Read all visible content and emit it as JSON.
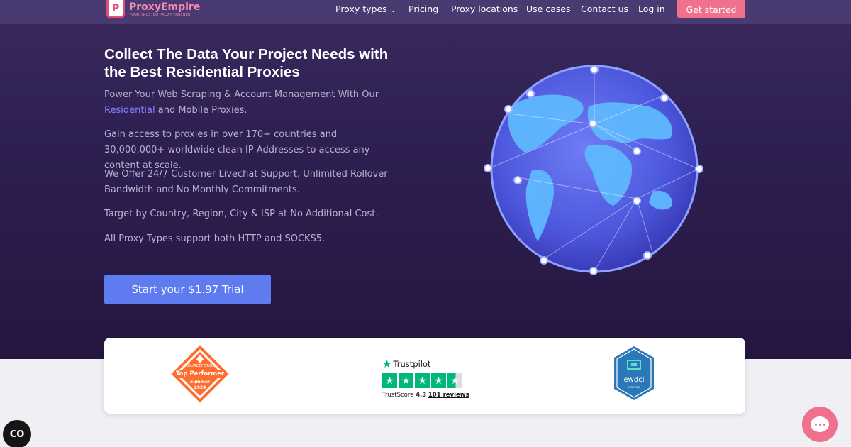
{
  "header": {
    "logo": {
      "name_part1": "Proxy",
      "name_part2": "Empire",
      "tagline": "YOUR TRUSTED PROXY PARTNER"
    },
    "nav": [
      {
        "label": "Proxy types",
        "has_dropdown": true
      },
      {
        "label": "Pricing"
      },
      {
        "label": "Proxy locations"
      },
      {
        "label": "Use cases"
      },
      {
        "label": "Contact us"
      },
      {
        "label": "Log in"
      }
    ],
    "cta_label": "Get started"
  },
  "hero": {
    "title": "Collect The Data Your Project Needs with the Best Residential Proxies",
    "p1_before": "Power Your Web Scraping & Account Management With Our ",
    "p1_link": "Residential",
    "p1_after": " and Mobile Proxies.",
    "p2": "Gain access to proxies in over 170+ countries and 30,000,000+ worldwide clean IP Addresses to access any content at scale.",
    "p3": "We Offer 24/7 Customer Livechat Support, Unlimited Rollover Bandwidth and No Monthly Commitments.",
    "p4": "Target by Country, Region, City & ISP at No Additional Cost.",
    "p5": "All Proxy Types support both HTTP and SOCKS5.",
    "trial_button": "Start your $1.97 Trial"
  },
  "badges": {
    "sourceforge": {
      "brand": "SOURCEFORGE",
      "title": "Top Performer",
      "season": "Summer",
      "year": "2024"
    },
    "trustpilot": {
      "brand": "Trustpilot",
      "score_label": "TrustScore",
      "score": "4.3",
      "reviews": "101 reviews",
      "rating_stars": 4.5
    },
    "ewdci": {
      "name": "ewdci",
      "sub": "CERTIFIED"
    }
  },
  "colors": {
    "accent": "#f0718e",
    "primary_button": "#5e7cf0",
    "trustpilot_green": "#00b67a"
  },
  "widgets": {
    "chat_icon": "chat-bubble-icon",
    "cookie_icon": "cookie-consent-icon",
    "cookie_label": "CO"
  }
}
